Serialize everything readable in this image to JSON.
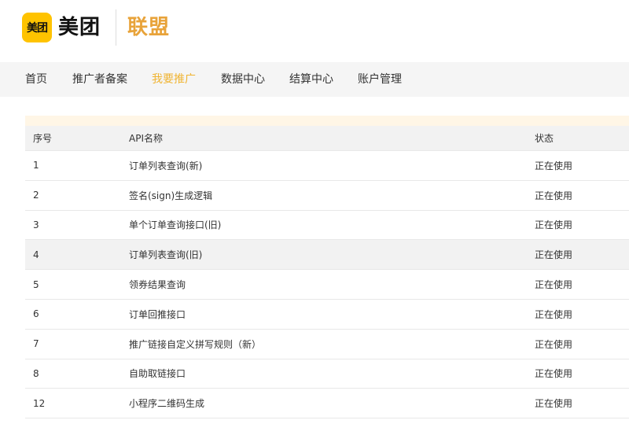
{
  "brand": {
    "badge_text": "美团",
    "name": "美团",
    "sub": "联盟",
    "brand_color": "#FFC300",
    "accent_color": "#E8A33A"
  },
  "nav": {
    "items": [
      {
        "label": "首页",
        "active": false
      },
      {
        "label": "推广者备案",
        "active": false
      },
      {
        "label": "我要推广",
        "active": true
      },
      {
        "label": "数据中心",
        "active": false
      },
      {
        "label": "结算中心",
        "active": false
      },
      {
        "label": "账户管理",
        "active": false
      }
    ],
    "active_color": "#F0B432"
  },
  "table": {
    "columns": [
      "序号",
      "API名称",
      "状态"
    ],
    "rows": [
      [
        "1",
        "订单列表查询(新)",
        "正在使用"
      ],
      [
        "2",
        "签名(sign)生成逻辑",
        "正在使用"
      ],
      [
        "3",
        "单个订单查询接口(旧)",
        "正在使用"
      ],
      [
        "4",
        "订单列表查询(旧)",
        "正在使用"
      ],
      [
        "5",
        "领券结果查询",
        "正在使用"
      ],
      [
        "6",
        "订单回推接口",
        "正在使用"
      ],
      [
        "7",
        "推广链接自定义拼写规则（新）",
        "正在使用"
      ],
      [
        "8",
        "自助取链接口",
        "正在使用"
      ],
      [
        "12",
        "小程序二维码生成",
        "正在使用"
      ]
    ],
    "highlighted_row": 3
  }
}
